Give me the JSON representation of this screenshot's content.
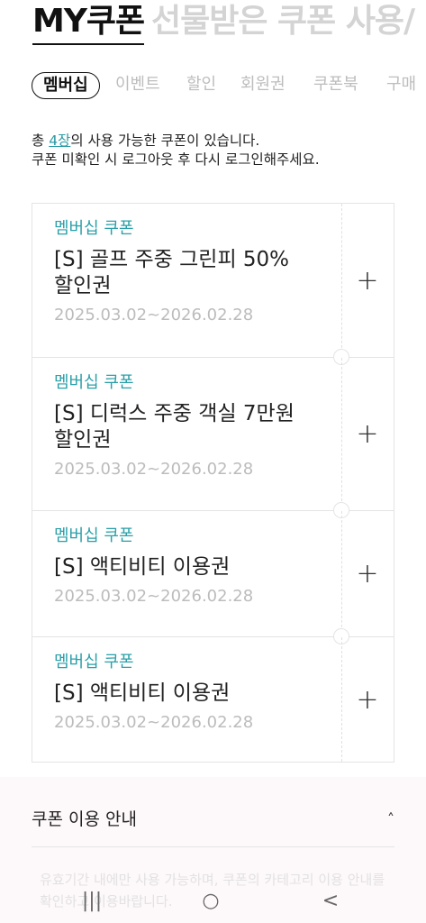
{
  "top_tabs": [
    {
      "label": "MY쿠폰",
      "active": true
    },
    {
      "label": "선물받은 쿠폰",
      "active": false
    },
    {
      "label": "사용/",
      "active": false
    }
  ],
  "sub_tabs": [
    {
      "label": "멤버십",
      "active": true
    },
    {
      "label": "이벤트",
      "active": false
    },
    {
      "label": "할인",
      "active": false
    },
    {
      "label": "회원권",
      "active": false
    },
    {
      "label": "쿠폰북",
      "active": false
    },
    {
      "label": "구매",
      "active": false
    }
  ],
  "info": {
    "line1_prefix": "총 ",
    "count": "4장",
    "line1_suffix": "의 사용 가능한 쿠폰이 있습니다.",
    "line2": "쿠폰 미확인 시 로그아웃 후 다시 로그인해주세요."
  },
  "coupons": [
    {
      "category": "멤버십 쿠폰",
      "name_line1": "[S] 골프 주중 그린피 50%",
      "name_line2": "할인권",
      "period": "2025.03.02~2026.02.28"
    },
    {
      "category": "멤버십 쿠폰",
      "name_line1": "[S] 디럭스 주중 객실 7만원",
      "name_line2": "할인권",
      "period": "2025.03.02~2026.02.28"
    },
    {
      "category": "멤버십 쿠폰",
      "name_line1": "[S] 액티비티 이용권",
      "name_line2": "",
      "period": "2025.03.02~2026.02.28"
    },
    {
      "category": "멤버십 쿠폰",
      "name_line1": "[S] 액티비티 이용권",
      "name_line2": "",
      "period": "2025.03.02~2026.02.28"
    }
  ],
  "plus_symbol": "+",
  "guide": {
    "title": "쿠폰 이용 안내",
    "chevron": "˄",
    "text": "유효기간 내에만 사용 가능하며, 쿠폰의 카테고리 이용 안내를 확인하고 이용바랍니다."
  },
  "nav": {
    "recents": "|||",
    "home": "○",
    "back": "<"
  },
  "colors": {
    "accent": "#2aa0a8",
    "inactive_tab": "#d4d4d4",
    "guide_bg": "#fdf8fa"
  }
}
